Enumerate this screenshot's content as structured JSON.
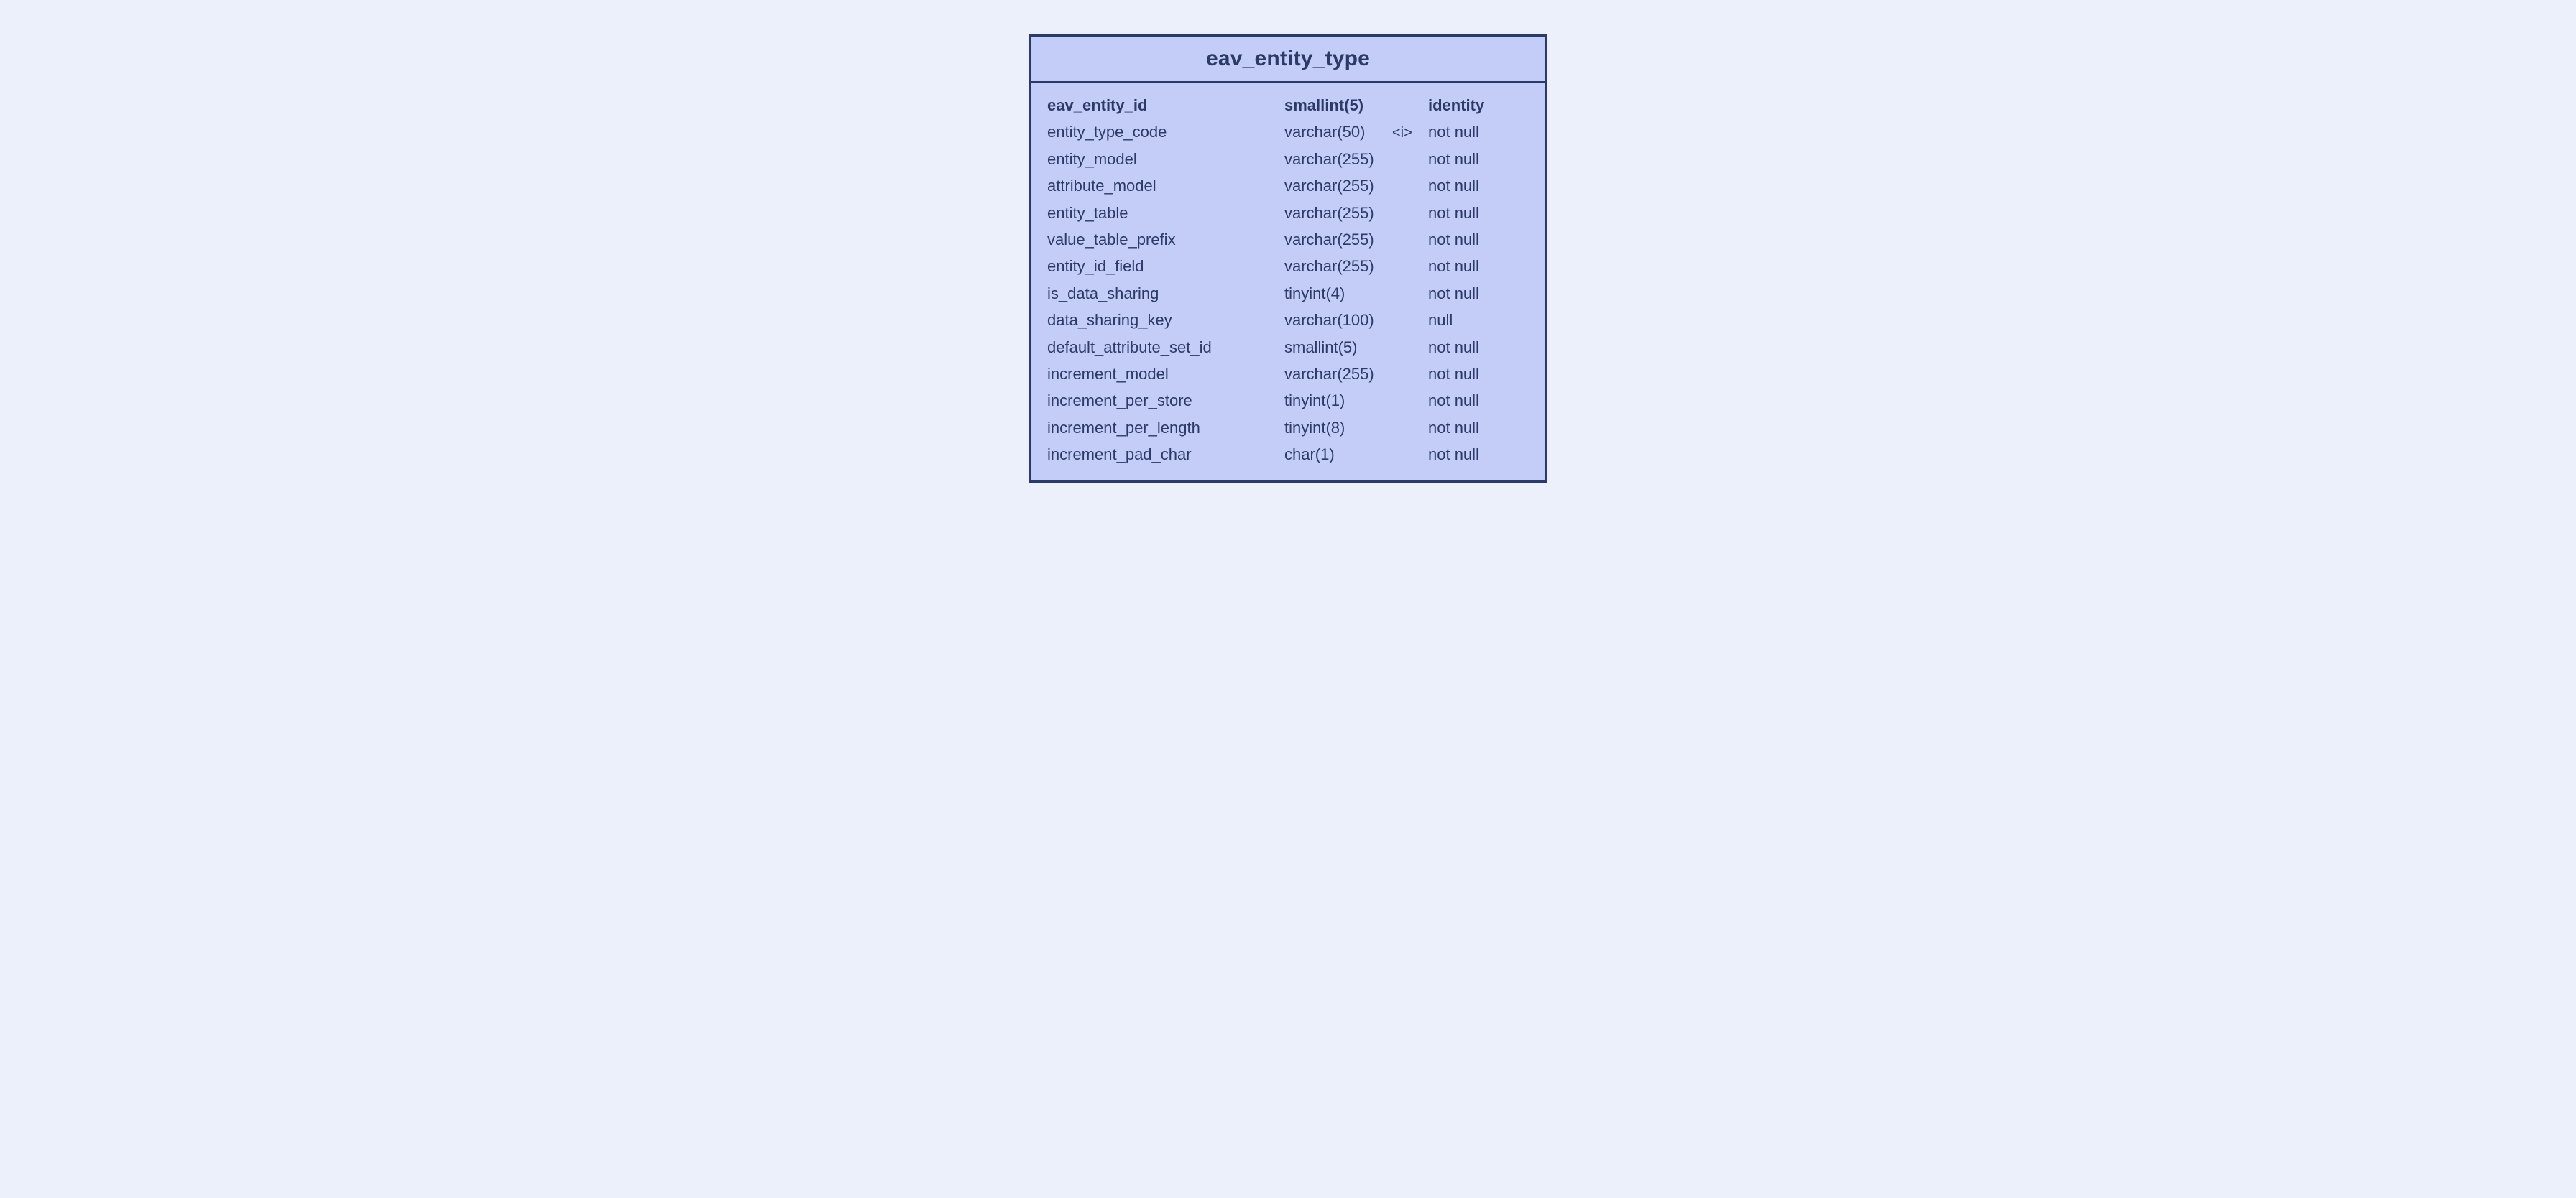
{
  "table": {
    "name": "eav_entity_type",
    "primary_key": {
      "name": "eav_entity_id",
      "type": "smallint(5)",
      "index_marker": "",
      "nullability": "identity"
    },
    "columns": [
      {
        "name": "entity_type_code",
        "type": "varchar(50)",
        "index_marker": "<i>",
        "nullability": "not null"
      },
      {
        "name": "entity_model",
        "type": "varchar(255)",
        "index_marker": "",
        "nullability": "not null"
      },
      {
        "name": "attribute_model",
        "type": "varchar(255)",
        "index_marker": "",
        "nullability": "not null"
      },
      {
        "name": "entity_table",
        "type": "varchar(255)",
        "index_marker": "",
        "nullability": "not null"
      },
      {
        "name": "value_table_prefix",
        "type": "varchar(255)",
        "index_marker": "",
        "nullability": "not null"
      },
      {
        "name": "entity_id_field",
        "type": "varchar(255)",
        "index_marker": "",
        "nullability": "not null"
      },
      {
        "name": "is_data_sharing",
        "type": "tinyint(4)",
        "index_marker": "",
        "nullability": "not null"
      },
      {
        "name": "data_sharing_key",
        "type": "varchar(100)",
        "index_marker": "",
        "nullability": "null"
      },
      {
        "name": "default_attribute_set_id",
        "type": "smallint(5)",
        "index_marker": "",
        "nullability": "not null"
      },
      {
        "name": "increment_model",
        "type": "varchar(255)",
        "index_marker": "",
        "nullability": "not null"
      },
      {
        "name": "increment_per_store",
        "type": "tinyint(1)",
        "index_marker": "",
        "nullability": "not null"
      },
      {
        "name": "increment_per_length",
        "type": "tinyint(8)",
        "index_marker": "",
        "nullability": "not null"
      },
      {
        "name": "increment_pad_char",
        "type": "char(1)",
        "index_marker": "",
        "nullability": "not null"
      }
    ]
  },
  "colors": {
    "page_bg": "#ebf0fa",
    "card_bg": "#c3cdf7",
    "border": "#2b3a67",
    "text": "#2b3a67"
  }
}
